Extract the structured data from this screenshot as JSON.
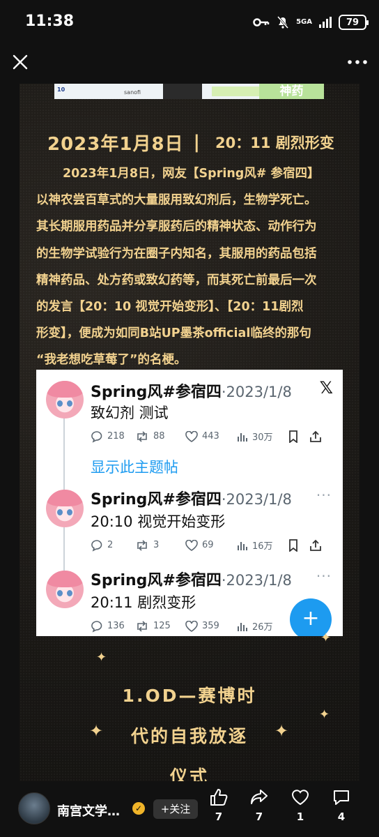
{
  "status_bar": {
    "time": "11:38",
    "network": "5GA",
    "battery": "79"
  },
  "top_bar": {
    "close": "close",
    "more": "more"
  },
  "banner": {
    "left_text": "10",
    "brand": "sanofi",
    "right_text": "神药"
  },
  "article": {
    "headline_date": "2023年1月8日",
    "headline_sep": "|",
    "headline_time": "20：11 剧烈形变",
    "paragraph_lines": [
      "2023年1月8日，网友【Spring风# 参宿四】",
      "以神农尝百草式的大量服用致幻剂后，生物学死亡。",
      "其长期服用药品并分享服药后的精神状态、动作行为",
      "的生物学试验行为在圈子内知名，其服用的药品包括",
      "精神药品、处方药或致幻药等，而其死亡前最后一次",
      "的发言【20：10 视觉开始变形】、【20：11剧烈",
      "形变】，便成为如同B站UP墨茶official临终的那句",
      "“我老想吃草莓了”的名梗。"
    ]
  },
  "embed": {
    "logo": "𝕏",
    "show_thread": "显示此主题帖",
    "posts": [
      {
        "name": "Spring风#参宿四",
        "meta": "·2023/1/8",
        "text": "致幻剂 测试",
        "replies": "218",
        "reposts": "88",
        "likes": "443",
        "views": "30万"
      },
      {
        "name": "Spring风#参宿四",
        "meta": "·2023/1/8",
        "text": "20:10 视觉开始变形",
        "replies": "2",
        "reposts": "3",
        "likes": "69",
        "views": "16万"
      },
      {
        "name": "Spring风#参宿四",
        "meta": "·2023/1/8",
        "text": "20:11 剧烈变形",
        "replies": "136",
        "reposts": "125",
        "likes": "359",
        "views": "26万"
      }
    ],
    "fab": "+"
  },
  "section": {
    "line1": "1.OD—赛博时",
    "line2": "代的自我放逐",
    "line3": "仪式"
  },
  "bottom_bar": {
    "author": "南宫文学…",
    "follow": "+关注",
    "likes": "7",
    "shares": "7",
    "favorites": "1",
    "comments": "4"
  }
}
